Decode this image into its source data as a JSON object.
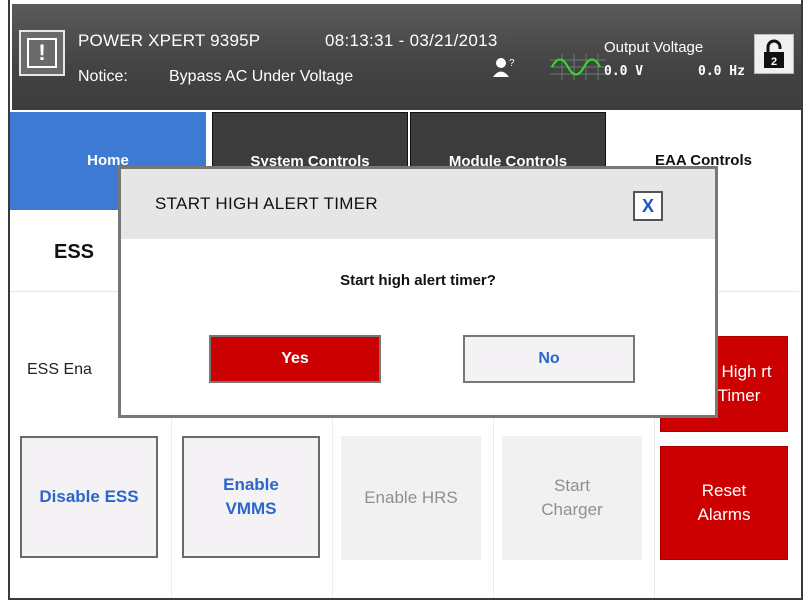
{
  "header": {
    "title": "POWER XPERT 9395P",
    "datetime": "08:13:31 - 03/21/2013",
    "notice_label": "Notice:",
    "notice_text": "Bypass AC Under Voltage",
    "help_glyph": "?",
    "output_voltage_label": "Output Voltage",
    "output_voltage_value": "0.0 V",
    "output_frequency_value": "0.0 Hz",
    "lock_level": "2",
    "alert_glyph": "!"
  },
  "tabs": [
    {
      "label": "Home"
    },
    {
      "label": "System Controls"
    },
    {
      "label": "Module Controls"
    },
    {
      "label": "EAA Controls"
    }
  ],
  "page": {
    "subtitle": "ESS",
    "ess_label": "ESS Ena"
  },
  "buttons": {
    "disable_ess": "Disable ESS",
    "enable_vmms": "Enable VMMS",
    "enable_hrs": "Enable HRS",
    "start_charger": "Start Charger",
    "start_high_alert": "rt High rt Timer",
    "reset_alarms": "Reset Alarms"
  },
  "dialog": {
    "title": "START HIGH ALERT TIMER",
    "close_label": "X",
    "message": "Start high alert timer?",
    "yes_label": "Yes",
    "no_label": "No"
  },
  "colors": {
    "home_tab": "#3d7ad3",
    "dark_tab": "#3c3c3c",
    "alert_red": "#cc0000",
    "link_blue": "#2b66c9"
  }
}
